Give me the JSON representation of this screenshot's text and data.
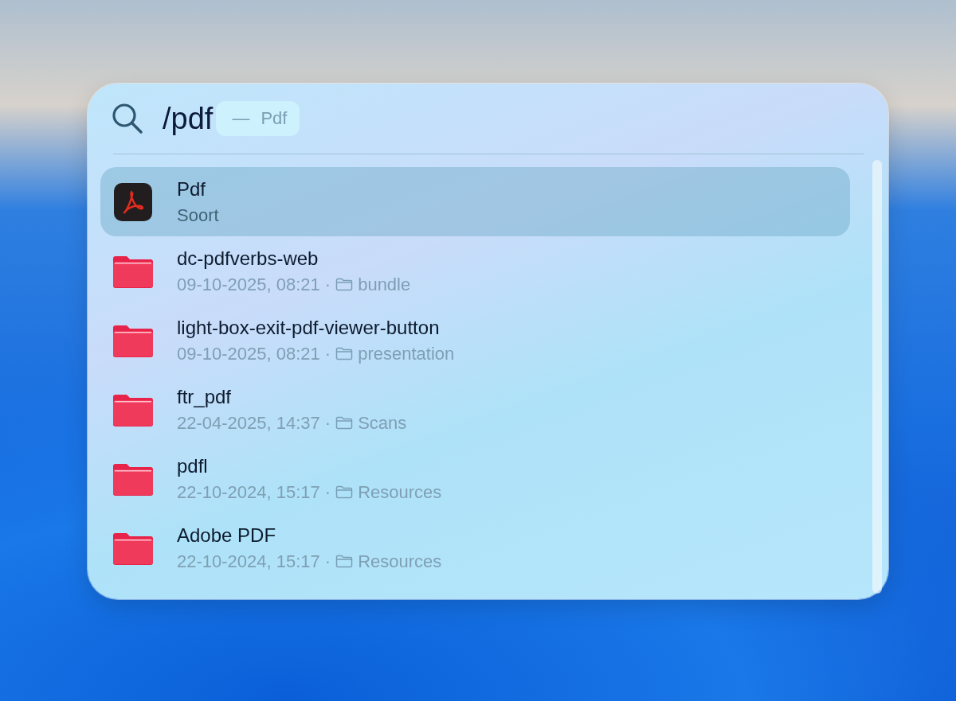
{
  "search": {
    "query": "/pdf",
    "suggestion_dash": "—",
    "suggestion": "Pdf"
  },
  "results": [
    {
      "kind": "app",
      "title": "Pdf",
      "subtitle": "Soort",
      "selected": true
    },
    {
      "kind": "folder",
      "title": "dc-pdfverbs-web",
      "date": "09-10-2025, 08:21",
      "separator": "·",
      "location": "bundle",
      "selected": false
    },
    {
      "kind": "folder",
      "title": "light-box-exit-pdf-viewer-button",
      "date": "09-10-2025, 08:21",
      "separator": "·",
      "location": "presentation",
      "selected": false
    },
    {
      "kind": "folder",
      "title": "ftr_pdf",
      "date": "22-04-2025, 14:37",
      "separator": "·",
      "location": "Scans",
      "selected": false
    },
    {
      "kind": "folder",
      "title": "pdfl",
      "date": "22-10-2024, 15:17",
      "separator": "·",
      "location": "Resources",
      "selected": false
    },
    {
      "kind": "folder",
      "title": "Adobe PDF",
      "date": "22-10-2024, 15:17",
      "separator": "·",
      "location": "Resources",
      "selected": false
    }
  ]
}
